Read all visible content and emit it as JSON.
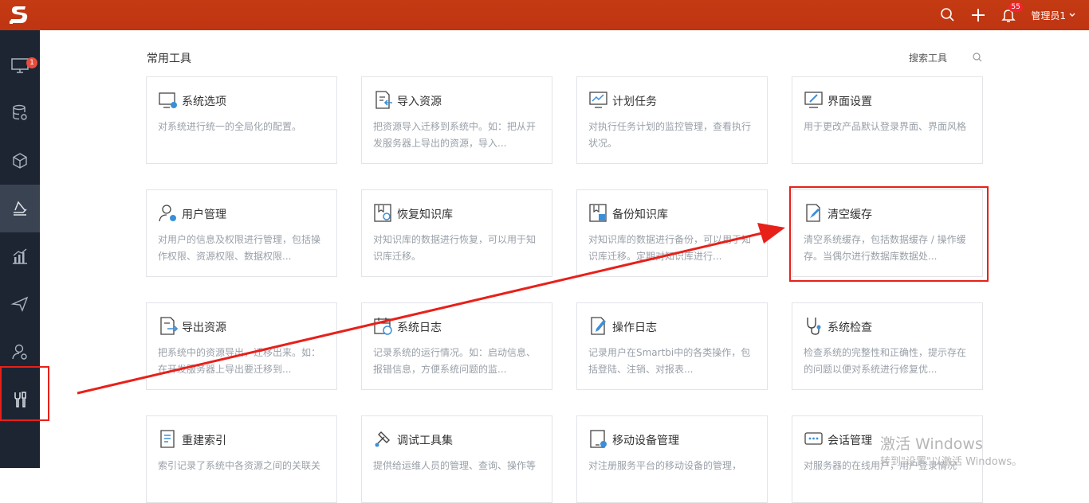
{
  "header": {
    "user_name": "管理员1",
    "notification_count": "55",
    "icons": [
      "search-icon",
      "plus-icon",
      "bell-icon",
      "chevron-down-icon"
    ]
  },
  "sidebar": {
    "items": [
      {
        "name": "monitor-icon",
        "badge": "1"
      },
      {
        "name": "database-settings-icon"
      },
      {
        "name": "cube-icon"
      },
      {
        "name": "layers-icon"
      },
      {
        "name": "bar-chart-icon"
      },
      {
        "name": "send-icon"
      },
      {
        "name": "user-settings-icon"
      },
      {
        "name": "tools-icon"
      }
    ]
  },
  "main": {
    "section_title": "常用工具",
    "search_label": "搜索工具",
    "cards": [
      {
        "title": "系统选项",
        "desc": "对系统进行统一的全局化的配置。",
        "icon": "system-options-icon"
      },
      {
        "title": "导入资源",
        "desc": "把资源导入迁移到系统中。如：把从开发服务器上导出的资源，导入...",
        "icon": "import-icon"
      },
      {
        "title": "计划任务",
        "desc": "对执行任务计划的监控管理，查看执行状况。",
        "icon": "schedule-icon"
      },
      {
        "title": "界面设置",
        "desc": "用于更改产品默认登录界面、界面风格",
        "icon": "ui-settings-icon"
      },
      {
        "title": "用户管理",
        "desc": "对用户的信息及权限进行管理，包括操作权限、资源权限、数据权限...",
        "icon": "user-management-icon"
      },
      {
        "title": "恢复知识库",
        "desc": "对知识库的数据进行恢复，可以用于知识库迁移。",
        "icon": "restore-icon"
      },
      {
        "title": "备份知识库",
        "desc": "对知识库的数据进行备份，可以用于知识库迁移。定期对知识库进行...",
        "icon": "backup-icon"
      },
      {
        "title": "清空缓存",
        "desc": "清空系统缓存，包括数据缓存 / 操作缓存。当偶尔进行数据库数据处...",
        "icon": "broom-icon"
      },
      {
        "title": "导出资源",
        "desc": "把系统中的资源导出，迁移出来。如：在开发服务器上导出要迁移到...",
        "icon": "export-icon"
      },
      {
        "title": "系统日志",
        "desc": "记录系统的运行情况。如：启动信息、报错信息，方便系统问题的监...",
        "icon": "system-log-icon"
      },
      {
        "title": "操作日志",
        "desc": "记录用户在Smartbi中的各类操作，包括登陆、注销、对报表...",
        "icon": "operation-log-icon"
      },
      {
        "title": "系统检查",
        "desc": "检查系统的完整性和正确性，提示存在的问题以便对系统进行修复优...",
        "icon": "stethoscope-icon"
      },
      {
        "title": "重建索引",
        "desc": "索引记录了系统中各资源之间的关联关",
        "icon": "rebuild-index-icon"
      },
      {
        "title": "调试工具集",
        "desc": "提供给运维人员的管理、查询、操作等",
        "icon": "debug-tools-icon"
      },
      {
        "title": "移动设备管理",
        "desc": "对注册服务平台的移动设备的管理，",
        "icon": "mobile-device-icon"
      },
      {
        "title": "会话管理",
        "desc": "对服务器的在线用户，用户登录情况",
        "icon": "session-icon"
      }
    ]
  },
  "watermark": {
    "line1": "激活 Windows",
    "line2": "转到\"设置\"以激活 Windows。"
  },
  "colors": {
    "header": "#c23616",
    "sidebar": "#1d2533",
    "highlight": "#e8201a"
  }
}
